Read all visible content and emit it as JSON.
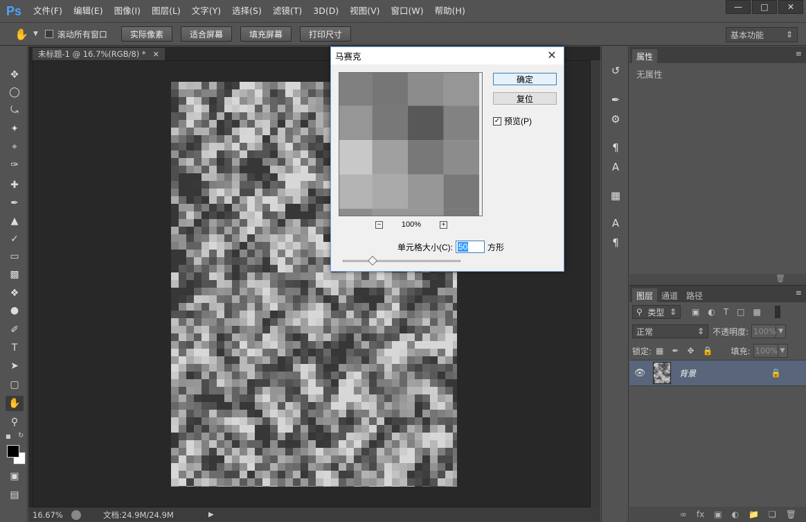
{
  "app": {
    "logo": "Ps",
    "menu": [
      "文件(F)",
      "编辑(E)",
      "图像(I)",
      "图层(L)",
      "文字(Y)",
      "选择(S)",
      "滤镜(T)",
      "3D(D)",
      "视图(V)",
      "窗口(W)",
      "帮助(H)"
    ],
    "window_controls": [
      "—",
      "□",
      "✕"
    ]
  },
  "options": {
    "scroll_all": "滚动所有窗口",
    "actual_pixels": "实际像素",
    "fit_screen": "适合屏幕",
    "fill_screen": "填充屏幕",
    "print_size": "打印尺寸",
    "workspace": "基本功能"
  },
  "document": {
    "tab_title": "未标题-1 @ 16.7%(RGB/8) *",
    "zoom": "16.67%",
    "doc_size": "文档:24.9M/24.9M"
  },
  "properties": {
    "tab": "属性",
    "empty": "无属性"
  },
  "layers": {
    "tabs": [
      "图层",
      "通道",
      "路径"
    ],
    "filter_kind": "类型",
    "blend_mode": "正常",
    "opacity_label": "不透明度:",
    "opacity_value": "100%",
    "lock_label": "锁定:",
    "fill_label": "填充:",
    "fill_value": "100%",
    "layer_name": "背景"
  },
  "dialog": {
    "title": "马赛克",
    "ok": "确定",
    "reset": "复位",
    "preview": "预览(P)",
    "preview_checked": true,
    "zoom": "100%",
    "cell_size_label": "单元格大小(C):",
    "cell_size_value": "50",
    "cell_unit": "方形",
    "slider_fraction": 0.25
  },
  "colors": {
    "accent": "#4aa3ff",
    "layer_selected": "#58657a",
    "workspace_bg": "#282828",
    "panel_bg": "#535353"
  }
}
